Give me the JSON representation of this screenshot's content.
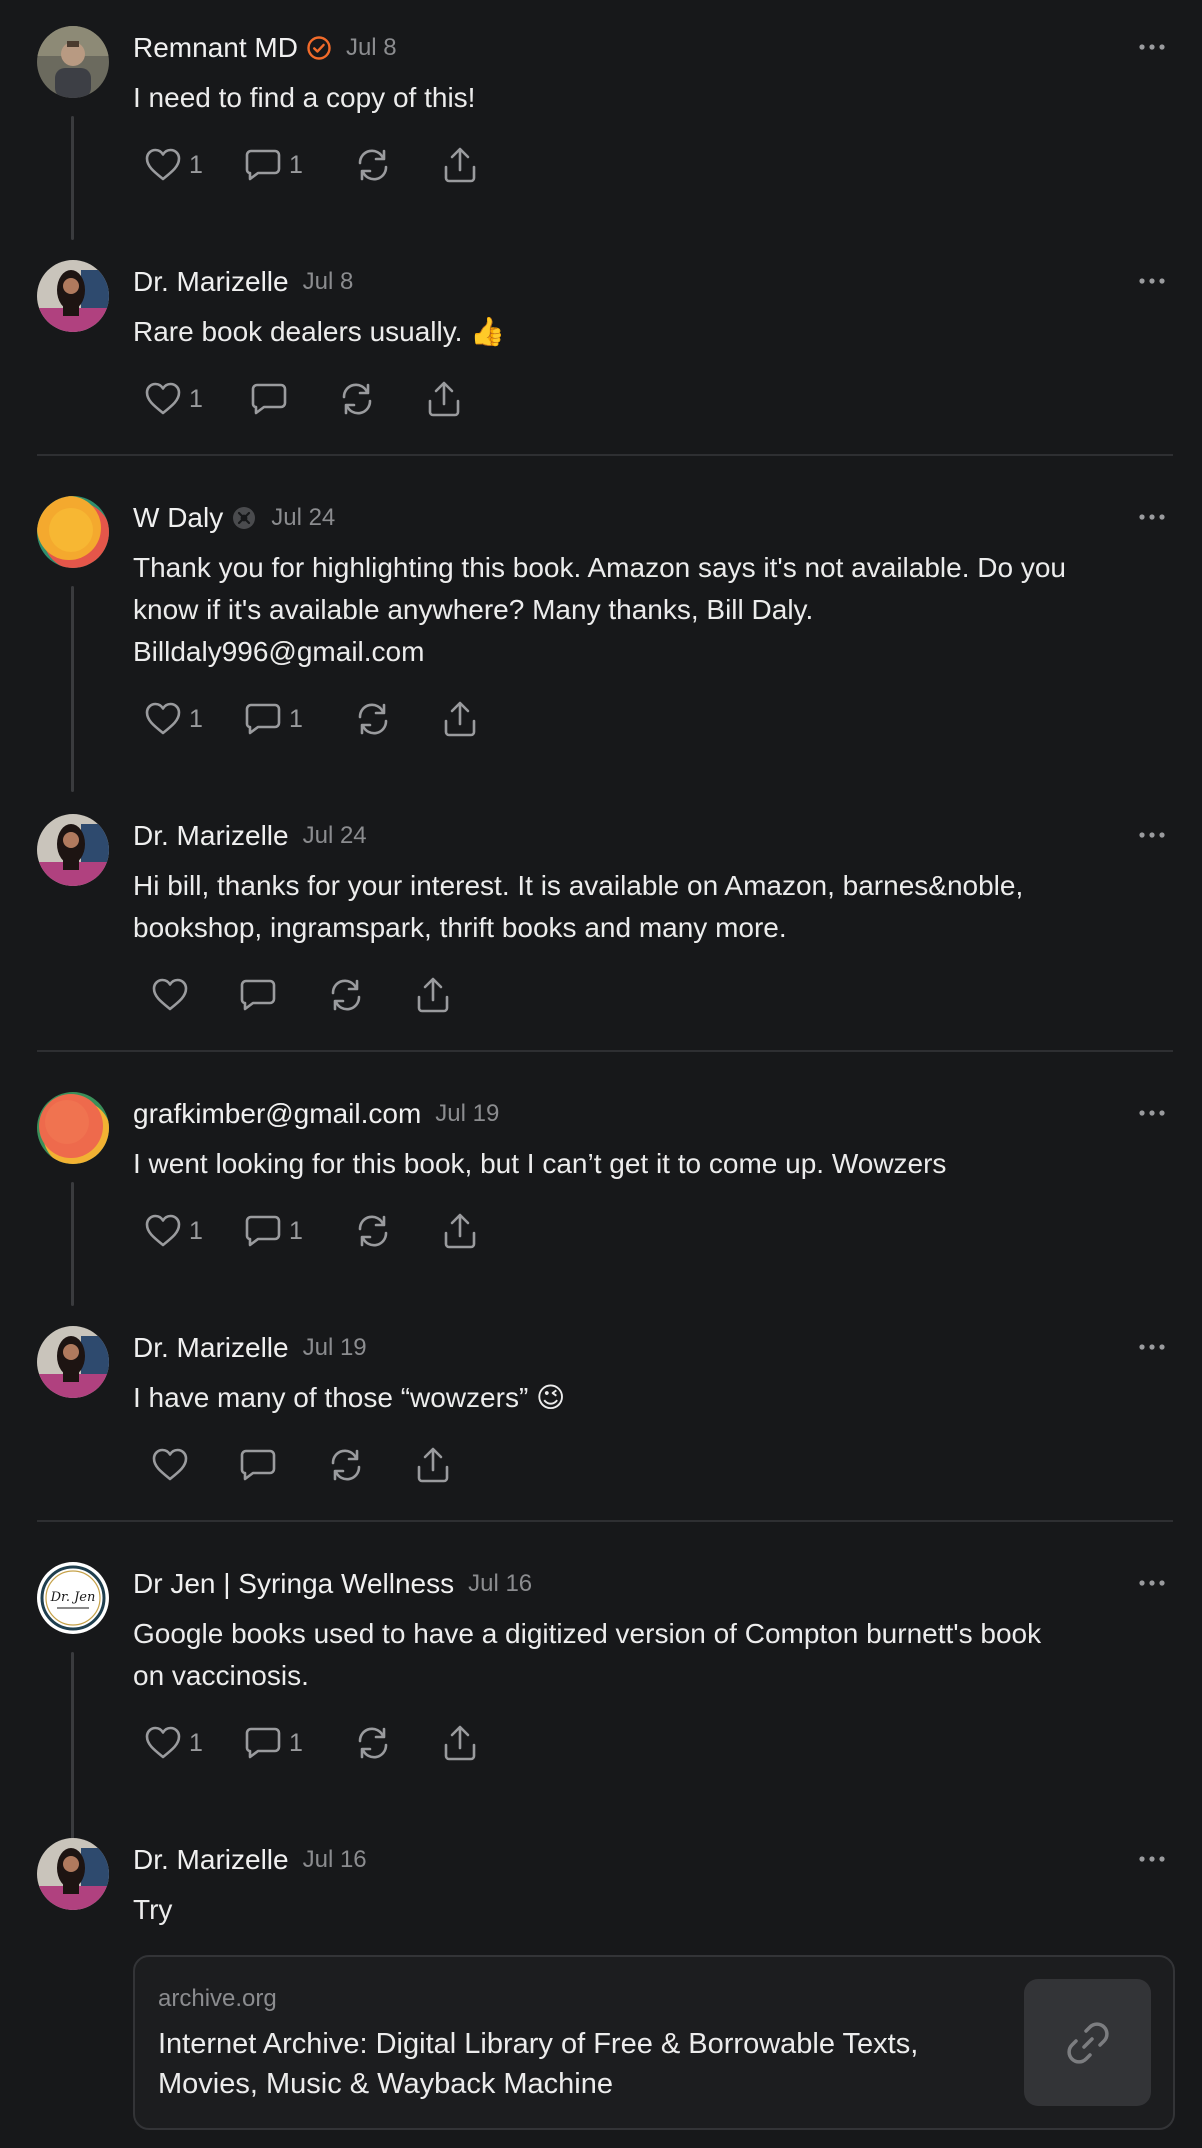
{
  "colors": {
    "background": "#17181a",
    "text": "#ececec",
    "muted": "#8b8c8f",
    "icon": "#9a9b9e",
    "verified_badge": "#f26b2a",
    "divider": "#2e2f32"
  },
  "comments": [
    {
      "author": "Remnant MD",
      "date": "Jul 8",
      "text": "I need to find a copy of this!",
      "likes": "1",
      "replies": "1",
      "badge": "verified-check-icon"
    },
    {
      "author": "Dr. Marizelle",
      "date": "Jul 8",
      "text": "Rare book dealers usually. 👍",
      "likes": "1",
      "replies": ""
    },
    {
      "author": "W Daly",
      "date": "Jul 24",
      "text": "Thank you for highlighting this book. Amazon says it's not available. Do you\nknow if it's available anywhere? Many thanks, Bill Daly.\nBilldaly996@gmail.com",
      "likes": "1",
      "replies": "1",
      "badge": "subscriber-badge-icon"
    },
    {
      "author": "Dr. Marizelle",
      "date": "Jul 24",
      "text": "Hi bill, thanks for your interest. It is available on Amazon, barnes&noble,\nbookshop, ingramspark, thrift books and many more.",
      "likes": "",
      "replies": ""
    },
    {
      "author": "grafkimber@gmail.com",
      "date": "Jul 19",
      "text": "I went looking for this book, but I can’t get it to come up. Wowzers",
      "likes": "1",
      "replies": "1"
    },
    {
      "author": "Dr. Marizelle",
      "date": "Jul 19",
      "text": "I have many of those “wowzers” 😉",
      "likes": "",
      "replies": ""
    },
    {
      "author": "Dr Jen | Syringa Wellness",
      "date": "Jul 16",
      "text": "Google books used to have a digitized version of Compton burnett's book\non vaccinosis.",
      "likes": "1",
      "replies": "1",
      "avatar_text": "Dr. Jen"
    },
    {
      "author": "Dr. Marizelle",
      "date": "Jul 16",
      "text": "Try",
      "likes": "",
      "replies": ""
    }
  ],
  "link_preview": {
    "domain": "archive.org",
    "title": "Internet Archive: Digital Library of Free & Borrowable Texts, Movies, Music & Wayback Machine",
    "icon": "link-icon"
  }
}
